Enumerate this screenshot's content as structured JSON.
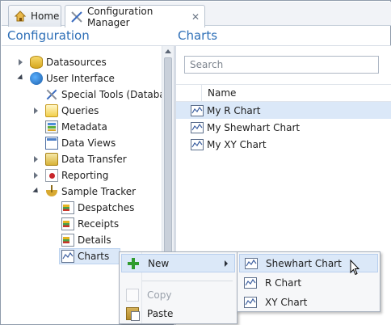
{
  "tabs": [
    {
      "label": "Home",
      "icon": "home-icon"
    },
    {
      "label": "Configuration Manager",
      "icon": "tools-icon",
      "close": "✕"
    }
  ],
  "left_pane": {
    "title": "Configuration",
    "tree": [
      {
        "label": "Datasources",
        "icon": "datasource-icon"
      },
      {
        "label": "User Interface",
        "icon": "user-interface-icon"
      },
      {
        "label": "Special Tools (Database",
        "icon": "tools-icon"
      },
      {
        "label": "Queries",
        "icon": "queries-icon"
      },
      {
        "label": "Metadata",
        "icon": "metadata-icon"
      },
      {
        "label": "Data Views",
        "icon": "data-views-icon"
      },
      {
        "label": "Data Transfer",
        "icon": "data-transfer-icon"
      },
      {
        "label": "Reporting",
        "icon": "reporting-icon"
      },
      {
        "label": "Sample Tracker",
        "icon": "sample-tracker-icon"
      },
      {
        "label": "Despatches",
        "icon": "form-icon"
      },
      {
        "label": "Receipts",
        "icon": "form-icon"
      },
      {
        "label": "Details",
        "icon": "form-icon"
      },
      {
        "label": "Charts",
        "icon": "chart-icon"
      }
    ]
  },
  "right_pane": {
    "title": "Charts",
    "search_placeholder": "Search",
    "column_header": "Name",
    "rows": [
      {
        "label": "My R Chart"
      },
      {
        "label": "My Shewhart Chart"
      },
      {
        "label": "My XY Chart"
      }
    ]
  },
  "context_menu": {
    "items": [
      {
        "label": "New",
        "icon": "plus-icon"
      },
      {
        "label": "Copy",
        "icon": "copy-icon"
      },
      {
        "label": "Paste",
        "icon": "paste-icon"
      }
    ],
    "submenu": [
      {
        "label": "Shewhart Chart",
        "icon": "chart-icon"
      },
      {
        "label": "R Chart",
        "icon": "chart-icon"
      },
      {
        "label": "XY Chart",
        "icon": "chart-icon"
      }
    ]
  }
}
